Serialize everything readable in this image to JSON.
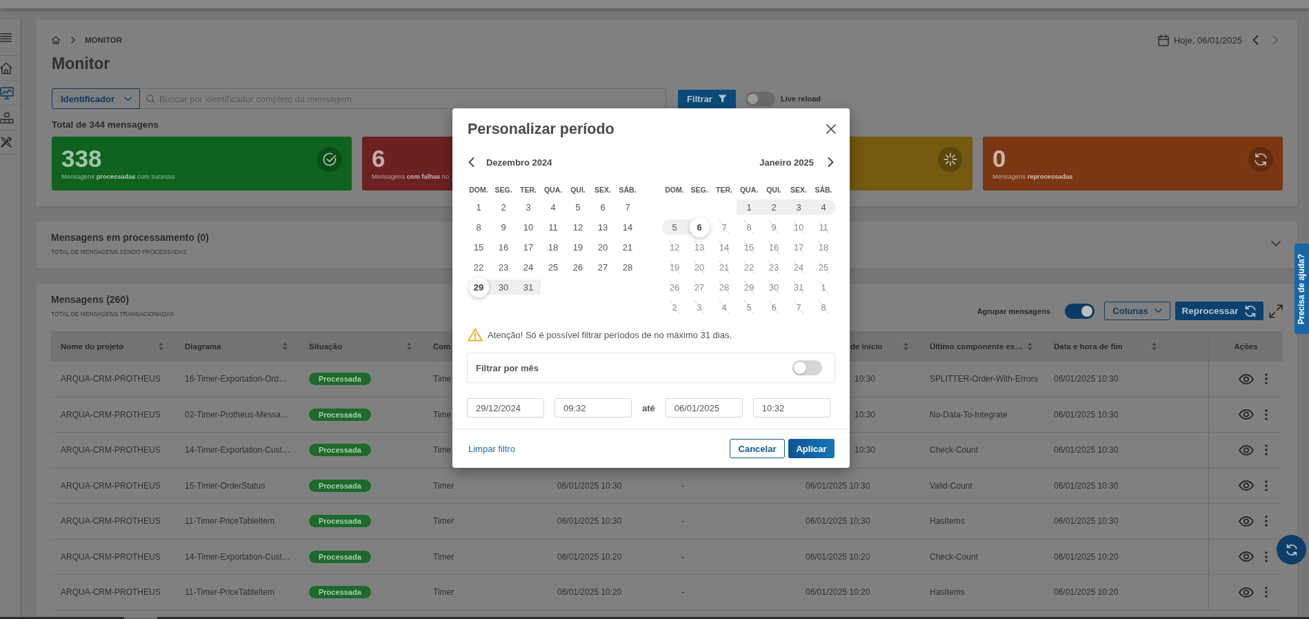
{
  "sidebar": {
    "items": [
      {
        "selected": false
      },
      {
        "selected": true
      },
      {
        "selected": false
      },
      {
        "selected": false
      }
    ]
  },
  "breadcrumb": {
    "current": "MONITOR"
  },
  "date_nav": {
    "label": "Hoje, 06/01/2025",
    "prev": {
      "disabled": false
    },
    "next": {
      "disabled": true
    }
  },
  "title": "Monitor",
  "filter_bar": {
    "field_select": "Identificador",
    "search": {
      "placeholder": "Buscar por identificador completo da mensagem"
    },
    "filter_button": "Filtrar",
    "live_reload": {
      "label": "Live reload",
      "on": false
    }
  },
  "total": "Total de 344 mensagens",
  "stat_cards": [
    {
      "kind": "success",
      "value": "338",
      "label": "Mensagens **processadas** com sucesso",
      "color": "#10621f"
    },
    {
      "kind": "failure",
      "value": "6",
      "label": "Mensagens **com falhas** no",
      "color": "#6b2121"
    },
    {
      "kind": "processing",
      "color": "#755a10"
    },
    {
      "kind": "reprocessed",
      "value": "0",
      "label": "Mensagens **reprocessadas**",
      "color": "#7b3713"
    }
  ],
  "processing_panel": {
    "title": "Mensagens em processamento (0)",
    "subtitle": "TOTAL DE MENSAGENS SENDO PROCESSADAS",
    "expanded": false
  },
  "messages_panel": {
    "title": "Mensagens (260)",
    "subtitle": "TOTAL DE MENSAGENS TRANSACIONADAS",
    "group_toggle": {
      "label": "Agrupar mensagens",
      "on": true
    },
    "columns_button": "Colunas",
    "reprocess_button": "Reprocessar",
    "table": {
      "columns": [
        {
          "kind": "text",
          "label": "Nome do projeto",
          "sortable": true,
          "starts_under_dialog": false
        },
        {
          "kind": "text",
          "label": "Diagrama",
          "sortable": true,
          "starts_under_dialog": false
        },
        {
          "kind": "status",
          "label": "Situação",
          "sortable": true,
          "starts_under_dialog": false
        },
        {
          "kind": "text",
          "label": "Com",
          "starts_under_dialog": false
        },
        {
          "kind": "text"
        },
        {
          "kind": "text"
        },
        {
          "kind": "text",
          "label": "de início",
          "sortable": true,
          "starts_under_dialog": true
        },
        {
          "kind": "text",
          "label": "Último componente ex…",
          "sortable": true,
          "starts_under_dialog": false
        },
        {
          "kind": "text",
          "label": "Data e hora de fim",
          "sortable": true,
          "starts_under_dialog": false
        },
        {
          "kind": "actions",
          "label": "Ações"
        }
      ],
      "rows": [
        {
          "under_dialog": true,
          "cells": [
            "ARQUA-CRM-PROTHEUS",
            "16-Timer-Exportation-Ord…",
            "Processada",
            "Time",
            null,
            null,
            "10:30",
            "SPLITTER-Order-With-Errors",
            "06/01/2025 10:30"
          ]
        },
        {
          "under_dialog": true,
          "cells": [
            "ARQUA-CRM-PROTHEUS",
            "02-Timer-Protheus-Messa…",
            "Processada",
            "Time",
            null,
            null,
            "10:30",
            "No-Data-To-Integrate",
            "06/01/2025 10:30"
          ]
        },
        {
          "under_dialog": true,
          "cells": [
            "ARQUA-CRM-PROTHEUS",
            "14-Timer-Exportation-Cust…",
            "Processada",
            "Time",
            null,
            null,
            "10:30",
            "Check-Count",
            "06/01/2025 10:30"
          ]
        },
        {
          "under_dialog": false,
          "cells": [
            "ARQUA-CRM-PROTHEUS",
            "15-Timer-OrderStatus",
            "Processada",
            "Timer",
            "06/01/2025 10:30",
            "-",
            "06/01/2025 10:30",
            "Valid-Count",
            "06/01/2025 10:30"
          ]
        },
        {
          "under_dialog": false,
          "cells": [
            "ARQUA-CRM-PROTHEUS",
            "11-Timer-PriceTableItem",
            "Processada",
            "Timer",
            "06/01/2025 10:30",
            "-",
            "06/01/2025 10:30",
            "HasItems",
            "06/01/2025 10:30"
          ]
        },
        {
          "under_dialog": false,
          "cells": [
            "ARQUA-CRM-PROTHEUS",
            "14-Timer-Exportation-Cust…",
            "Processada",
            "Timer",
            "06/01/2025 10:20",
            "-",
            "06/01/2025 10:20",
            "Check-Count",
            "06/01/2025 10:20"
          ]
        },
        {
          "under_dialog": false,
          "cells": [
            "ARQUA-CRM-PROTHEUS",
            "11-Timer-PriceTableItem",
            "Processada",
            "Timer",
            "06/01/2025 10:20",
            "-",
            "06/01/2025 10:20",
            "HasItems",
            "06/01/2025 10:20"
          ]
        }
      ]
    }
  },
  "dialog": {
    "title": "Personalizar período",
    "months": [
      {
        "title": "Dezembro 2024",
        "weekdays": [
          "DOM.",
          "SEG.",
          "TER.",
          "QUA.",
          "QUI.",
          "SEX.",
          "SÁB."
        ],
        "weeks": [
          {
            "kind": "full",
            "days": [
              {
                "day": "1",
                "selected": false,
                "in_range": false,
                "disabled": false
              },
              {
                "day": "2",
                "selected": false,
                "in_range": false,
                "disabled": false
              },
              {
                "day": "3",
                "selected": false,
                "in_range": false,
                "disabled": false
              },
              {
                "day": "4",
                "selected": false,
                "in_range": false,
                "disabled": false
              },
              {
                "day": "5",
                "selected": false,
                "in_range": false,
                "disabled": false
              },
              {
                "day": "6",
                "selected": false,
                "in_range": false,
                "disabled": false
              },
              {
                "day": "7",
                "selected": false,
                "in_range": false,
                "disabled": false
              }
            ]
          },
          {
            "kind": "full",
            "days": [
              {
                "day": "8",
                "selected": false,
                "in_range": false,
                "disabled": false
              },
              {
                "day": "9",
                "selected": false,
                "in_range": false,
                "disabled": false
              },
              {
                "day": "10",
                "selected": false,
                "in_range": false,
                "disabled": false
              },
              {
                "day": "11",
                "selected": false,
                "in_range": false,
                "disabled": false
              },
              {
                "day": "12",
                "selected": false,
                "in_range": false,
                "disabled": false
              },
              {
                "day": "13",
                "selected": false,
                "in_range": false,
                "disabled": false
              },
              {
                "day": "14",
                "selected": false,
                "in_range": false,
                "disabled": false
              }
            ]
          },
          {
            "kind": "full",
            "days": [
              {
                "day": "15",
                "selected": false,
                "in_range": false,
                "disabled": false
              },
              {
                "day": "16",
                "selected": false,
                "in_range": false,
                "disabled": false
              },
              {
                "day": "17",
                "selected": false,
                "in_range": false,
                "disabled": false
              },
              {
                "day": "18",
                "selected": false,
                "in_range": false,
                "disabled": false
              },
              {
                "day": "19",
                "selected": false,
                "in_range": false,
                "disabled": false
              },
              {
                "day": "20",
                "selected": false,
                "in_range": false,
                "disabled": false
              },
              {
                "day": "21",
                "selected": false,
                "in_range": false,
                "disabled": false
              }
            ]
          },
          {
            "kind": "full",
            "days": [
              {
                "day": "22",
                "selected": false,
                "in_range": false,
                "disabled": false
              },
              {
                "day": "23",
                "selected": false,
                "in_range": false,
                "disabled": false
              },
              {
                "day": "24",
                "selected": false,
                "in_range": false,
                "disabled": false
              },
              {
                "day": "25",
                "selected": false,
                "in_range": false,
                "disabled": false
              },
              {
                "day": "26",
                "selected": false,
                "in_range": false,
                "disabled": false
              },
              {
                "day": "27",
                "selected": false,
                "in_range": false,
                "disabled": false
              },
              {
                "day": "28",
                "selected": false,
                "in_range": false,
                "disabled": false
              }
            ]
          },
          {
            "kind": "last",
            "days": [
              {
                "day": "29",
                "selected": true,
                "in_range": false,
                "disabled": false
              },
              {
                "day": "30",
                "selected": false,
                "in_range": true,
                "disabled": false
              },
              {
                "day": "31",
                "selected": false,
                "in_range": true,
                "disabled": false
              }
            ]
          }
        ]
      },
      {
        "title": "Janeiro 2025",
        "weekdays": [
          "DOM.",
          "SEG.",
          "TER.",
          "QUA.",
          "QUI.",
          "SEX.",
          "SÁB."
        ],
        "weeks": [
          {
            "kind": "first",
            "days": [
              {
                "day": "1",
                "selected": false,
                "in_range": true,
                "disabled": false
              },
              {
                "day": "2",
                "selected": false,
                "in_range": true,
                "disabled": false
              },
              {
                "day": "3",
                "selected": false,
                "in_range": true,
                "disabled": false
              },
              {
                "day": "4",
                "selected": false,
                "in_range": true,
                "disabled": false
              }
            ]
          },
          {
            "kind": "full",
            "days": [
              {
                "day": "5",
                "selected": false,
                "in_range": true,
                "disabled": false
              },
              {
                "day": "6",
                "selected": true,
                "in_range": false,
                "disabled": false
              },
              {
                "day": "7",
                "selected": false,
                "in_range": false,
                "disabled": true
              },
              {
                "day": "8",
                "selected": false,
                "in_range": false,
                "disabled": true
              },
              {
                "day": "9",
                "selected": false,
                "in_range": false,
                "disabled": true
              },
              {
                "day": "10",
                "selected": false,
                "in_range": false,
                "disabled": true
              },
              {
                "day": "11",
                "selected": false,
                "in_range": false,
                "disabled": true
              }
            ]
          },
          {
            "kind": "full",
            "days": [
              {
                "day": "12",
                "selected": false,
                "in_range": false,
                "disabled": true
              },
              {
                "day": "13",
                "selected": false,
                "in_range": false,
                "disabled": true
              },
              {
                "day": "14",
                "selected": false,
                "in_range": false,
                "disabled": true
              },
              {
                "day": "15",
                "selected": false,
                "in_range": false,
                "disabled": true
              },
              {
                "day": "16",
                "selected": false,
                "in_range": false,
                "disabled": true
              },
              {
                "day": "17",
                "selected": false,
                "in_range": false,
                "disabled": true
              },
              {
                "day": "18",
                "selected": false,
                "in_range": false,
                "disabled": true
              }
            ]
          },
          {
            "kind": "full",
            "days": [
              {
                "day": "19",
                "selected": false,
                "in_range": false,
                "disabled": true
              },
              {
                "day": "20",
                "selected": false,
                "in_range": false,
                "disabled": true
              },
              {
                "day": "21",
                "selected": false,
                "in_range": false,
                "disabled": true
              },
              {
                "day": "22",
                "selected": false,
                "in_range": false,
                "disabled": true
              },
              {
                "day": "23",
                "selected": false,
                "in_range": false,
                "disabled": true
              },
              {
                "day": "24",
                "selected": false,
                "in_range": false,
                "disabled": true
              },
              {
                "day": "25",
                "selected": false,
                "in_range": false,
                "disabled": true
              }
            ]
          },
          {
            "kind": "full",
            "days": [
              {
                "day": "26",
                "selected": false,
                "in_range": false,
                "disabled": true
              },
              {
                "day": "27",
                "selected": false,
                "in_range": false,
                "disabled": true
              },
              {
                "day": "28",
                "selected": false,
                "in_range": false,
                "disabled": true
              },
              {
                "day": "29",
                "selected": false,
                "in_range": false,
                "disabled": true
              },
              {
                "day": "30",
                "selected": false,
                "in_range": false,
                "disabled": true
              },
              {
                "day": "31",
                "selected": false,
                "in_range": false,
                "disabled": true
              },
              {
                "day": "1",
                "selected": false,
                "in_range": false,
                "disabled": true
              }
            ]
          },
          {
            "kind": "full",
            "days": [
              {
                "day": "2",
                "selected": false,
                "in_range": false,
                "disabled": true
              },
              {
                "day": "3",
                "selected": false,
                "in_range": false,
                "disabled": true
              },
              {
                "day": "4",
                "selected": false,
                "in_range": false,
                "disabled": true
              },
              {
                "day": "5",
                "selected": false,
                "in_range": false,
                "disabled": true
              },
              {
                "day": "6",
                "selected": false,
                "in_range": false,
                "disabled": true
              },
              {
                "day": "7",
                "selected": false,
                "in_range": false,
                "disabled": true
              },
              {
                "day": "8",
                "selected": false,
                "in_range": false,
                "disabled": true
              }
            ]
          }
        ]
      }
    ],
    "warning": "Atenção! Só é possível filtrar períodos de no máximo 31 dias.",
    "month_filter": {
      "label": "Filtrar por mês",
      "on": false
    },
    "range_fields": [
      {
        "kind": "date",
        "value": "29/12/2024"
      },
      {
        "kind": "time",
        "value": "09:32"
      },
      {
        "kind": "separator",
        "text": "até"
      },
      {
        "kind": "date",
        "value": "06/01/2025"
      },
      {
        "kind": "time",
        "value": "10:32"
      }
    ],
    "clear_link": "Limpar filtro",
    "buttons": [
      {
        "kind": "secondary",
        "label": "Cancelar"
      },
      {
        "kind": "primary",
        "label": "Aplicar"
      }
    ]
  },
  "help_tab": "Precisa de ajuda?"
}
